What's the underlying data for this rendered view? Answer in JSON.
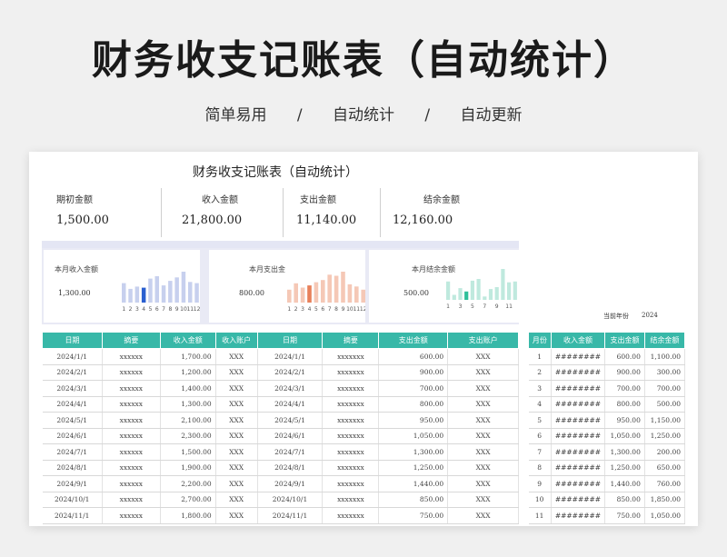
{
  "header": {
    "title": "财务收支记账表（自动统计）",
    "subtitle": [
      "简单易用",
      "/",
      "自动统计",
      "/",
      "自动更新"
    ]
  },
  "sheet": {
    "title": "财务收支记账表（自动统计）",
    "summary": [
      {
        "label": "期初金额",
        "value": "1,500.00"
      },
      {
        "label": "收入金额",
        "value": "21,800.00"
      },
      {
        "label": "支出金额",
        "value": "11,140.00"
      },
      {
        "label": "结余金额",
        "value": "12,160.00"
      }
    ],
    "panels": [
      {
        "label": "本月收入金额",
        "value": "1,300.00"
      },
      {
        "label": "本月支出金",
        "value": "800.00"
      },
      {
        "label": "本月结余金额",
        "value": "500.00"
      }
    ],
    "year_label": "当前年份",
    "year_value": "2024",
    "income_table": {
      "headers": [
        "日期",
        "摘要",
        "收入金额",
        "收入账户"
      ]
    },
    "expense_table": {
      "headers": [
        "日期",
        "摘要",
        "支出金额",
        "支出账户"
      ]
    },
    "monthly_table": {
      "headers": [
        "月份",
        "收入金额",
        "支出金额",
        "结余金额"
      ]
    },
    "rows": [
      {
        "in_date": "2024/1/1",
        "in_desc": "xxxxxx",
        "in_amt": "1,700.00",
        "in_acct": "XXX",
        "out_date": "2024/1/1",
        "out_desc": "xxxxxxx",
        "out_amt": "600.00",
        "out_acct": "XXX",
        "m": "1",
        "m_in": "########",
        "m_out": "600.00",
        "m_bal": "1,100.00"
      },
      {
        "in_date": "2024/2/1",
        "in_desc": "xxxxxx",
        "in_amt": "1,200.00",
        "in_acct": "XXX",
        "out_date": "2024/2/1",
        "out_desc": "xxxxxxx",
        "out_amt": "900.00",
        "out_acct": "XXX",
        "m": "2",
        "m_in": "########",
        "m_out": "900.00",
        "m_bal": "300.00"
      },
      {
        "in_date": "2024/3/1",
        "in_desc": "xxxxxx",
        "in_amt": "1,400.00",
        "in_acct": "XXX",
        "out_date": "2024/3/1",
        "out_desc": "xxxxxxx",
        "out_amt": "700.00",
        "out_acct": "XXX",
        "m": "3",
        "m_in": "########",
        "m_out": "700.00",
        "m_bal": "700.00"
      },
      {
        "in_date": "2024/4/1",
        "in_desc": "xxxxxx",
        "in_amt": "1,300.00",
        "in_acct": "XXX",
        "out_date": "2024/4/1",
        "out_desc": "xxxxxxx",
        "out_amt": "800.00",
        "out_acct": "XXX",
        "m": "4",
        "m_in": "########",
        "m_out": "800.00",
        "m_bal": "500.00"
      },
      {
        "in_date": "2024/5/1",
        "in_desc": "xxxxxx",
        "in_amt": "2,100.00",
        "in_acct": "XXX",
        "out_date": "2024/5/1",
        "out_desc": "xxxxxxx",
        "out_amt": "950.00",
        "out_acct": "XXX",
        "m": "5",
        "m_in": "########",
        "m_out": "950.00",
        "m_bal": "1,150.00"
      },
      {
        "in_date": "2024/6/1",
        "in_desc": "xxxxxx",
        "in_amt": "2,300.00",
        "in_acct": "XXX",
        "out_date": "2024/6/1",
        "out_desc": "xxxxxxx",
        "out_amt": "1,050.00",
        "out_acct": "XXX",
        "m": "6",
        "m_in": "########",
        "m_out": "1,050.00",
        "m_bal": "1,250.00"
      },
      {
        "in_date": "2024/7/1",
        "in_desc": "xxxxxx",
        "in_amt": "1,500.00",
        "in_acct": "XXX",
        "out_date": "2024/7/1",
        "out_desc": "xxxxxxx",
        "out_amt": "1,300.00",
        "out_acct": "XXX",
        "m": "7",
        "m_in": "########",
        "m_out": "1,300.00",
        "m_bal": "200.00"
      },
      {
        "in_date": "2024/8/1",
        "in_desc": "xxxxxx",
        "in_amt": "1,900.00",
        "in_acct": "XXX",
        "out_date": "2024/8/1",
        "out_desc": "xxxxxxx",
        "out_amt": "1,250.00",
        "out_acct": "XXX",
        "m": "8",
        "m_in": "########",
        "m_out": "1,250.00",
        "m_bal": "650.00"
      },
      {
        "in_date": "2024/9/1",
        "in_desc": "xxxxxx",
        "in_amt": "2,200.00",
        "in_acct": "XXX",
        "out_date": "2024/9/1",
        "out_desc": "xxxxxxx",
        "out_amt": "1,440.00",
        "out_acct": "XXX",
        "m": "9",
        "m_in": "########",
        "m_out": "1,440.00",
        "m_bal": "760.00"
      },
      {
        "in_date": "2024/10/1",
        "in_desc": "xxxxxx",
        "in_amt": "2,700.00",
        "in_acct": "XXX",
        "out_date": "2024/10/1",
        "out_desc": "xxxxxxx",
        "out_amt": "850.00",
        "out_acct": "XXX",
        "m": "10",
        "m_in": "########",
        "m_out": "850.00",
        "m_bal": "1,850.00"
      },
      {
        "in_date": "2024/11/1",
        "in_desc": "xxxxxx",
        "in_amt": "1,800.00",
        "in_acct": "XXX",
        "out_date": "2024/11/1",
        "out_desc": "xxxxxxx",
        "out_amt": "750.00",
        "out_acct": "XXX",
        "m": "11",
        "m_in": "########",
        "m_out": "750.00",
        "m_bal": "1,050.00"
      }
    ]
  },
  "chart_data": [
    {
      "type": "bar",
      "categories": [
        "1",
        "2",
        "3",
        "4",
        "5",
        "6",
        "7",
        "8",
        "9",
        "10",
        "11",
        "12"
      ],
      "tick_labels": [
        "1",
        "2",
        "3",
        "4",
        "5",
        "6",
        "7",
        "8",
        "9",
        "10",
        "11",
        "12"
      ],
      "values": [
        1700,
        1200,
        1400,
        1300,
        2100,
        2300,
        1500,
        1900,
        2200,
        2700,
        1800,
        1700
      ],
      "highlight_index": 3,
      "colors": {
        "bar": "#c7d0ee",
        "highlight": "#2a5fd0"
      }
    },
    {
      "type": "bar",
      "categories": [
        "1",
        "2",
        "3",
        "4",
        "5",
        "6",
        "7",
        "8",
        "9",
        "10",
        "11",
        "12"
      ],
      "tick_labels": [
        "1",
        "2",
        "3",
        "4",
        "5",
        "6",
        "7",
        "8",
        "9",
        "10",
        "11",
        "12"
      ],
      "values": [
        600,
        900,
        700,
        800,
        950,
        1050,
        1300,
        1250,
        1440,
        850,
        750,
        600
      ],
      "highlight_index": 3,
      "colors": {
        "bar": "#f5c8b6",
        "highlight": "#e8805a"
      }
    },
    {
      "type": "bar",
      "categories": [
        "1",
        "2",
        "3",
        "4",
        "5",
        "6",
        "7",
        "8",
        "9",
        "10",
        "11",
        "12"
      ],
      "tick_labels": [
        "1",
        "3",
        "5",
        "7",
        "9",
        "11"
      ],
      "values": [
        1100,
        300,
        700,
        500,
        1150,
        1250,
        200,
        650,
        760,
        1850,
        1050,
        1100
      ],
      "highlight_index": 3,
      "colors": {
        "bar": "#bfe9de",
        "highlight": "#2fbf9a"
      }
    }
  ]
}
